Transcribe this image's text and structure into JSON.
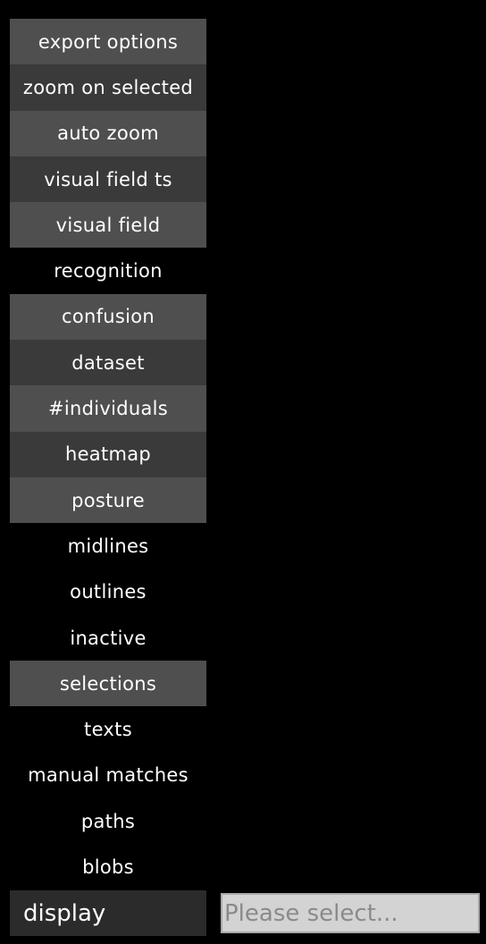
{
  "menu": {
    "items": [
      {
        "label": "export options"
      },
      {
        "label": "zoom on selected"
      },
      {
        "label": "auto zoom"
      },
      {
        "label": "visual field ts"
      },
      {
        "label": "visual field"
      },
      {
        "label": "recognition"
      },
      {
        "label": "confusion"
      },
      {
        "label": "dataset"
      },
      {
        "label": "#individuals"
      },
      {
        "label": "heatmap"
      },
      {
        "label": "posture"
      },
      {
        "label": "midlines"
      },
      {
        "label": "outlines"
      },
      {
        "label": "inactive"
      },
      {
        "label": "selections"
      },
      {
        "label": "texts"
      },
      {
        "label": "manual matches"
      },
      {
        "label": "paths"
      },
      {
        "label": "blobs"
      }
    ]
  },
  "footer": {
    "display_label": "display",
    "select_placeholder": "Please select..."
  },
  "colors": {
    "background": "#000000",
    "item_active_light": "#4f4f4f",
    "item_active_dark": "#3a3a3a",
    "text": "#ffffff",
    "select_bg": "#d3d3d3",
    "select_text": "#8a8a8a"
  }
}
